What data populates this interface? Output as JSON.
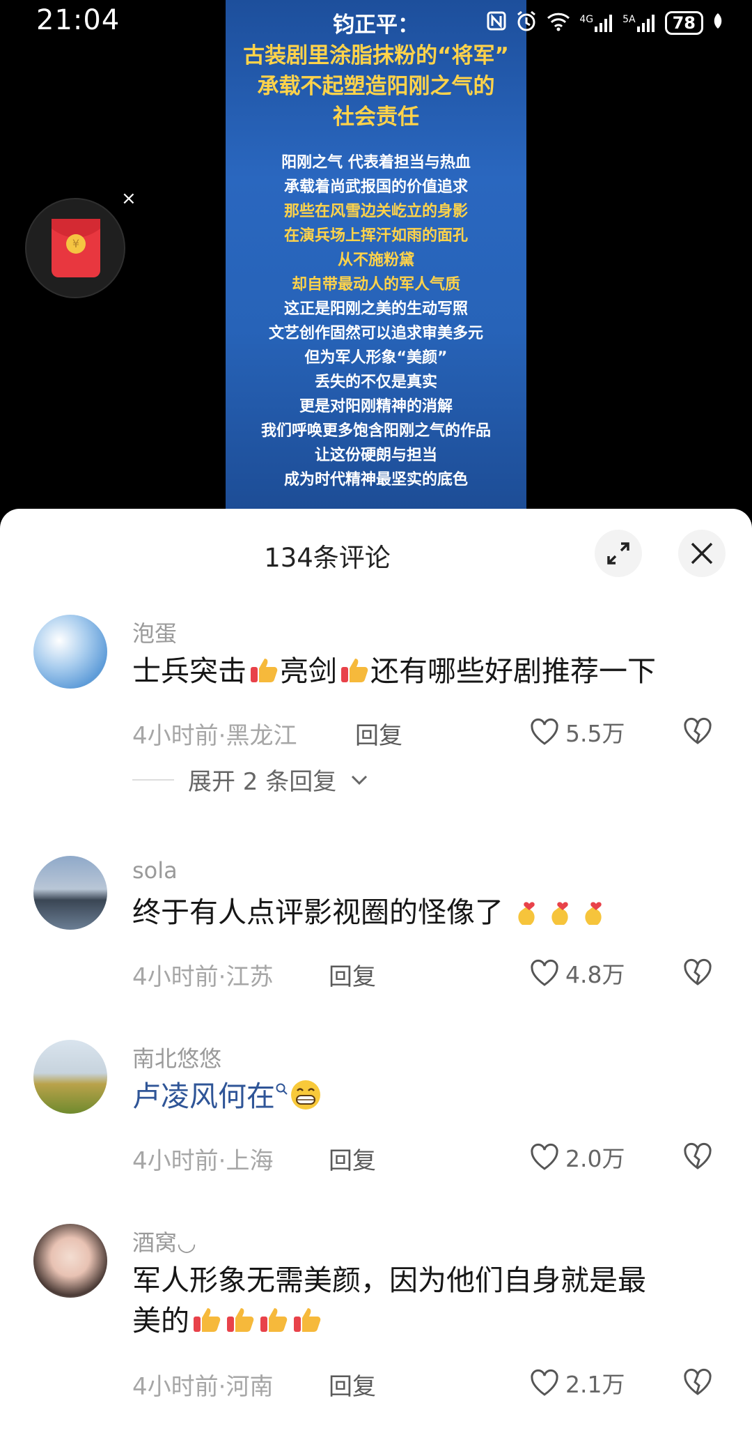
{
  "status_bar": {
    "time": "21:04",
    "signal_a": "4G",
    "signal_b": "5A",
    "battery": "78"
  },
  "video": {
    "title_lines": [
      "钧正平：",
      "古装剧里涂脂抹粉的“将军”",
      "承载不起塑造阳刚之气的",
      "社会责任"
    ],
    "body_lines": [
      "阳刚之气 代表着担当与热血",
      "承载着尚武报国的价值追求",
      "那些在风雪边关屹立的身影",
      "在演兵场上挥汗如雨的面孔",
      "从不施粉黛",
      "却自带最动人的军人气质",
      "这正是阳刚之美的生动写照",
      "文艺创作固然可以追求审美多元",
      "但为军人形象“美颜”",
      "丢失的不仅是真实",
      "更是对阳刚精神的消解",
      "我们呼唤更多饱含阳刚之气的作品",
      "让这份硬朗与担当",
      "成为时代精神最坚实的底色"
    ]
  },
  "redpack": {
    "close": "×",
    "seal": "¥"
  },
  "sheet": {
    "title": "134条评论",
    "expand_replies": "展开 2 条回复"
  },
  "comments": [
    {
      "name": "泡蛋",
      "text_parts": [
        "士兵突击",
        "亮剑",
        "还有哪些好剧推荐一下"
      ],
      "meta": "4小时前·黑龙江",
      "reply": "回复",
      "likes": "5.5万"
    },
    {
      "name": "sola",
      "text": "终于有人点评影视圈的怪像了",
      "meta": "4小时前·江苏",
      "reply": "回复",
      "likes": "4.8万"
    },
    {
      "name": "南北悠悠",
      "text": "卢凌风何在",
      "meta": "4小时前·上海",
      "reply": "回复",
      "likes": "2.0万"
    },
    {
      "name": "酒窝◡",
      "text": "军人形象无需美颜，因为他们自身就是最美的",
      "meta": "4小时前·河南",
      "reply": "回复",
      "likes": "2.1万"
    }
  ]
}
